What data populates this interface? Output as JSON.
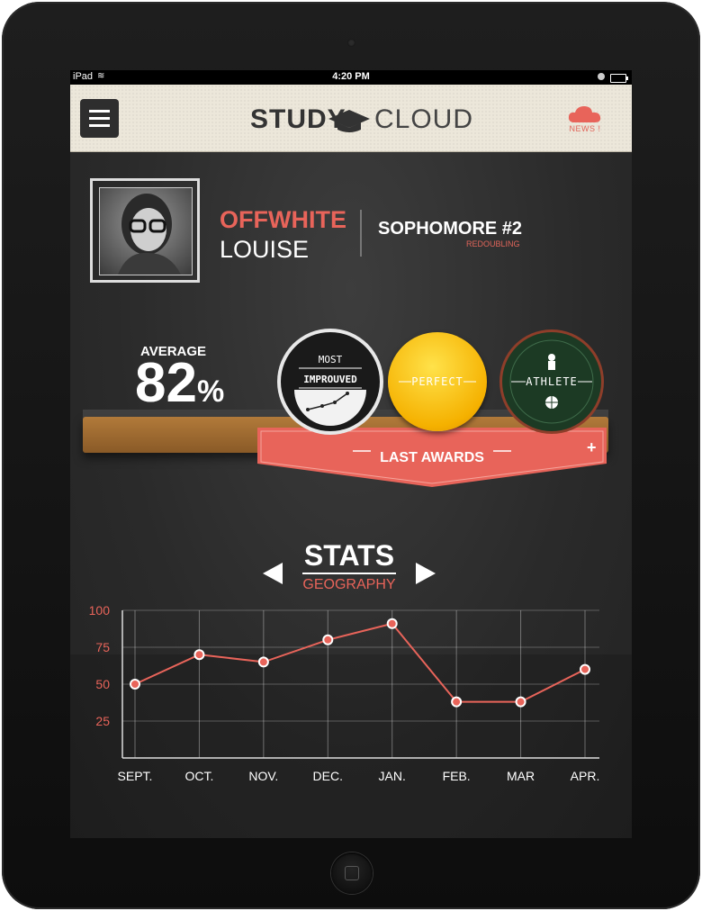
{
  "statusbar": {
    "carrier": "iPad",
    "time": "4:20 PM"
  },
  "header": {
    "logo_study": "STUDY",
    "logo_cloud": "CLOUD",
    "news_label": "NEWS !"
  },
  "profile": {
    "first_name": "OFFWHITE",
    "last_name": "LOUISE",
    "grade": "SOPHOMORE #2",
    "grade_sub": "REDOUBLING"
  },
  "average": {
    "label": "AVERAGE",
    "value": "82",
    "unit": "%"
  },
  "awards": {
    "label": "LAST AWARDS",
    "plus": "+",
    "items": [
      {
        "top": "MOST",
        "main": "IMPROUVED"
      },
      {
        "main": "PERFECT"
      },
      {
        "main": "ATHLETE"
      }
    ]
  },
  "stats": {
    "title": "STATS",
    "subject": "GEOGRAPHY"
  },
  "chart_data": {
    "type": "line",
    "categories": [
      "SEPT.",
      "OCT.",
      "NOV.",
      "DEC.",
      "JAN.",
      "FEB.",
      "MAR",
      "APR."
    ],
    "values": [
      50,
      70,
      65,
      80,
      91,
      38,
      38,
      60
    ],
    "yticks": [
      25,
      50,
      75,
      100
    ],
    "ylim": [
      0,
      100
    ],
    "color": "#e8645a"
  }
}
